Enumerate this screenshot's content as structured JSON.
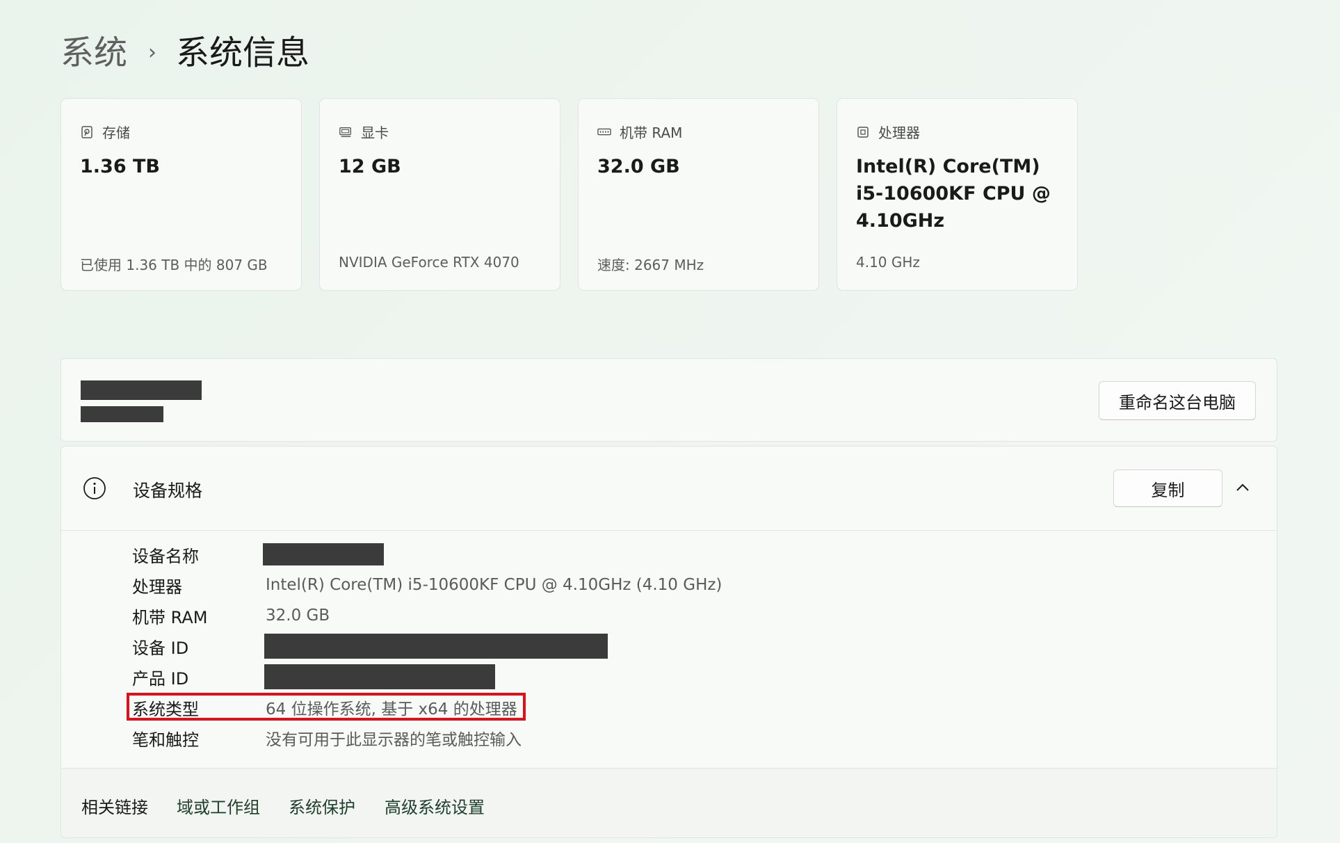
{
  "breadcrumb": {
    "parent": "系统",
    "separator": "›",
    "current": "系统信息"
  },
  "cards": [
    {
      "title": "存储",
      "icon": "storage-icon",
      "value": "1.36 TB",
      "sub": "已使用 1.36 TB 中的 807 GB"
    },
    {
      "title": "显卡",
      "icon": "gpu-icon",
      "value": "12 GB",
      "sub": "NVIDIA GeForce RTX 4070"
    },
    {
      "title": "机带 RAM",
      "icon": "ram-icon",
      "value": "32.0 GB",
      "sub": "速度: 2667 MHz"
    },
    {
      "title": "处理器",
      "icon": "cpu-icon",
      "value": "Intel(R) Core(TM) i5-10600KF CPU @ 4.10GHz",
      "sub": "4.10 GHz"
    }
  ],
  "pc": {
    "rename_label": "重命名这台电脑"
  },
  "specs": {
    "title": "设备规格",
    "copy_label": "复制",
    "rows": [
      {
        "label": "设备名称",
        "value": ""
      },
      {
        "label": "处理器",
        "value": "Intel(R) Core(TM) i5-10600KF CPU @ 4.10GHz (4.10 GHz)"
      },
      {
        "label": "机带 RAM",
        "value": "32.0 GB"
      },
      {
        "label": "设备 ID",
        "value": ""
      },
      {
        "label": "产品 ID",
        "value": ""
      },
      {
        "label": "系统类型",
        "value": "64 位操作系统, 基于 x64 的处理器"
      },
      {
        "label": "笔和触控",
        "value": "没有可用于此显示器的笔或触控输入"
      }
    ]
  },
  "related": {
    "label": "相关链接",
    "links": [
      "域或工作组",
      "系统保护",
      "高级系统设置"
    ]
  },
  "colors": {
    "highlight": "#e0101b",
    "link": "#1d3f2a",
    "redaction": "#3b3b3b"
  }
}
